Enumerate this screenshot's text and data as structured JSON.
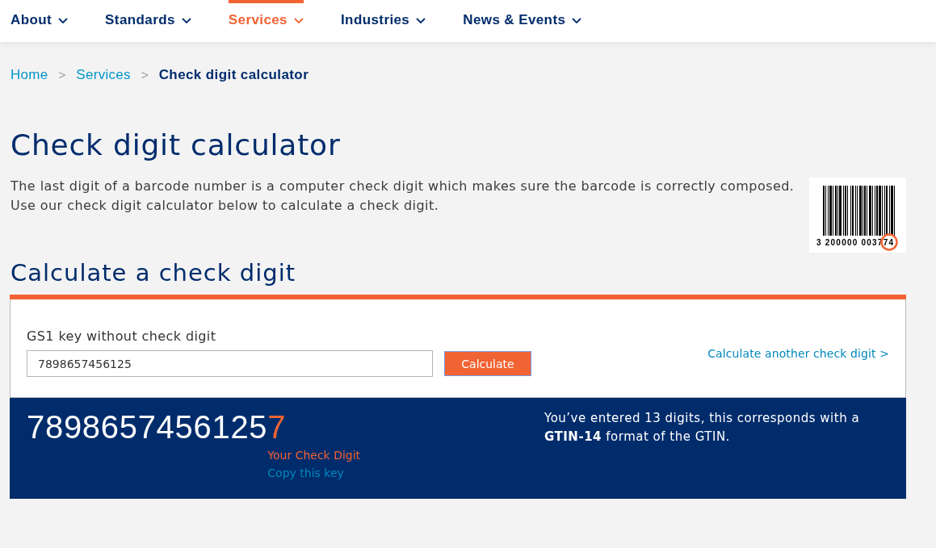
{
  "nav": {
    "items": [
      {
        "label": "About",
        "selected": false
      },
      {
        "label": "Standards",
        "selected": false
      },
      {
        "label": "Services",
        "selected": true
      },
      {
        "label": "Industries",
        "selected": false
      },
      {
        "label": "News & Events",
        "selected": false
      }
    ]
  },
  "breadcrumb": [
    {
      "kind": "link",
      "label": "Home"
    },
    {
      "kind": "separator",
      "label": ">"
    },
    {
      "kind": "link",
      "label": "Services"
    },
    {
      "kind": "separator",
      "label": ">"
    },
    {
      "kind": "current",
      "label": "Check digit calculator"
    }
  ],
  "page": {
    "title": "Check digit calculator",
    "intro": "The last digit of a barcode number is a computer check digit which makes sure the barcode is correctly composed. Use our check digit calculator below to calculate a check digit.",
    "barcode": {
      "number": "3 200000 003774"
    }
  },
  "calculator": {
    "title": "Calculate a check digit",
    "field": {
      "label": "GS1 key without check digit",
      "value": "7898657456125"
    },
    "button": "Calculate",
    "another_link": "Calculate another check digit >",
    "result": {
      "key": "7898657456125",
      "check_digit": "7",
      "check_digit_label": "Your Check Digit",
      "copy_link": "Copy this key",
      "message": "You’ve entered 13 digits, this corresponds with a **GTIN-14** format of the GTIN."
    }
  }
}
